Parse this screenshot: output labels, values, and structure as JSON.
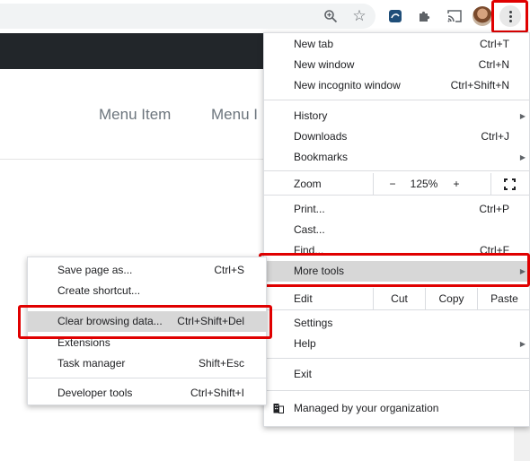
{
  "toolbar": {
    "icons": [
      "zoom-icon",
      "star-icon",
      "extension-icon",
      "puzzle-icon",
      "cast-icon",
      "avatar",
      "kebab-icon"
    ]
  },
  "page": {
    "nav_items": [
      "Menu Item",
      "Menu I"
    ]
  },
  "menu": {
    "new_tab": {
      "label": "New tab",
      "shortcut": "Ctrl+T"
    },
    "new_window": {
      "label": "New window",
      "shortcut": "Ctrl+N"
    },
    "new_incognito": {
      "label": "New incognito window",
      "shortcut": "Ctrl+Shift+N"
    },
    "history": {
      "label": "History"
    },
    "downloads": {
      "label": "Downloads",
      "shortcut": "Ctrl+J"
    },
    "bookmarks": {
      "label": "Bookmarks"
    },
    "zoom": {
      "label": "Zoom",
      "minus": "−",
      "value": "125%",
      "plus": "+"
    },
    "print": {
      "label": "Print...",
      "shortcut": "Ctrl+P"
    },
    "cast": {
      "label": "Cast..."
    },
    "find": {
      "label": "Find...",
      "shortcut": "Ctrl+F"
    },
    "more_tools": {
      "label": "More tools"
    },
    "edit": {
      "label": "Edit",
      "cut": "Cut",
      "copy": "Copy",
      "paste": "Paste"
    },
    "settings": {
      "label": "Settings"
    },
    "help": {
      "label": "Help"
    },
    "exit": {
      "label": "Exit"
    },
    "managed": {
      "label": "Managed by your organization"
    }
  },
  "submenu": {
    "save_page": {
      "label": "Save page as...",
      "shortcut": "Ctrl+S"
    },
    "create_shortcut": {
      "label": "Create shortcut..."
    },
    "clear_browsing": {
      "label": "Clear browsing data...",
      "shortcut": "Ctrl+Shift+Del"
    },
    "extensions": {
      "label": "Extensions"
    },
    "task_manager": {
      "label": "Task manager",
      "shortcut": "Shift+Esc"
    },
    "developer_tools": {
      "label": "Developer tools",
      "shortcut": "Ctrl+Shift+I"
    }
  },
  "colors": {
    "highlight": "#e00000",
    "hover": "#d7d7d7",
    "dark_bar": "#22262a"
  }
}
